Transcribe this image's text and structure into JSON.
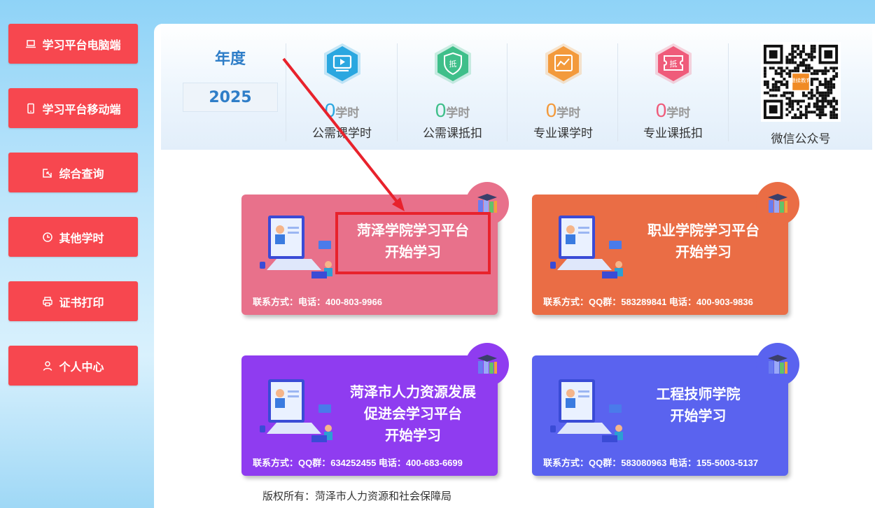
{
  "sidebar": {
    "items": [
      {
        "label": "学习平台电脑端",
        "icon": "laptop-icon"
      },
      {
        "label": "学习平台移动端",
        "icon": "phone-icon"
      },
      {
        "label": "综合查询",
        "icon": "query-icon"
      },
      {
        "label": "其他学时",
        "icon": "clock-icon"
      },
      {
        "label": "证书打印",
        "icon": "printer-icon"
      },
      {
        "label": "个人中心",
        "icon": "user-icon"
      }
    ]
  },
  "stats": {
    "year_title": "年度",
    "year_value": "2025",
    "items": [
      {
        "value": "0",
        "unit": "学时",
        "label": "公需课学时",
        "color": "#2aa7e0",
        "icon": "monitor-play-icon"
      },
      {
        "value": "0",
        "unit": "学时",
        "label": "公需课抵扣",
        "color": "#3fbf8a",
        "icon": "shield-deduct-icon",
        "icon_text": "抵"
      },
      {
        "value": "0",
        "unit": "学时",
        "label": "专业课学时",
        "color": "#f39a3c",
        "icon": "chart-icon"
      },
      {
        "value": "0",
        "unit": "学时",
        "label": "专业课抵扣",
        "color": "#ef5b7a",
        "icon": "ticket-deduct-icon",
        "icon_text": "抵"
      }
    ],
    "qr_label": "微信公众号",
    "qr_logo_text": "继续教育"
  },
  "cards": [
    {
      "title_lines": [
        "菏泽学院学习平台",
        "开始学习"
      ],
      "contact": "联系方式：电话：400-803-9966",
      "color": "#e8718b"
    },
    {
      "title_lines": [
        "职业学院学习平台",
        "开始学习"
      ],
      "contact": "联系方式：QQ群：583289841 电话：400-903-9836",
      "color": "#ea6d45"
    },
    {
      "title_lines": [
        "菏泽市人力资源发展",
        "促进会学习平台",
        "开始学习"
      ],
      "contact": "联系方式：QQ群：634252455 电话：400-683-6699",
      "color": "#8f3cf0"
    },
    {
      "title_lines": [
        "工程技师学院",
        "开始学习"
      ],
      "contact": "联系方式：QQ群：583080963 电话：155-5003-5137",
      "color": "#5a63ef"
    }
  ],
  "footer": "版权所有：菏泽市人力资源和社会保障局"
}
